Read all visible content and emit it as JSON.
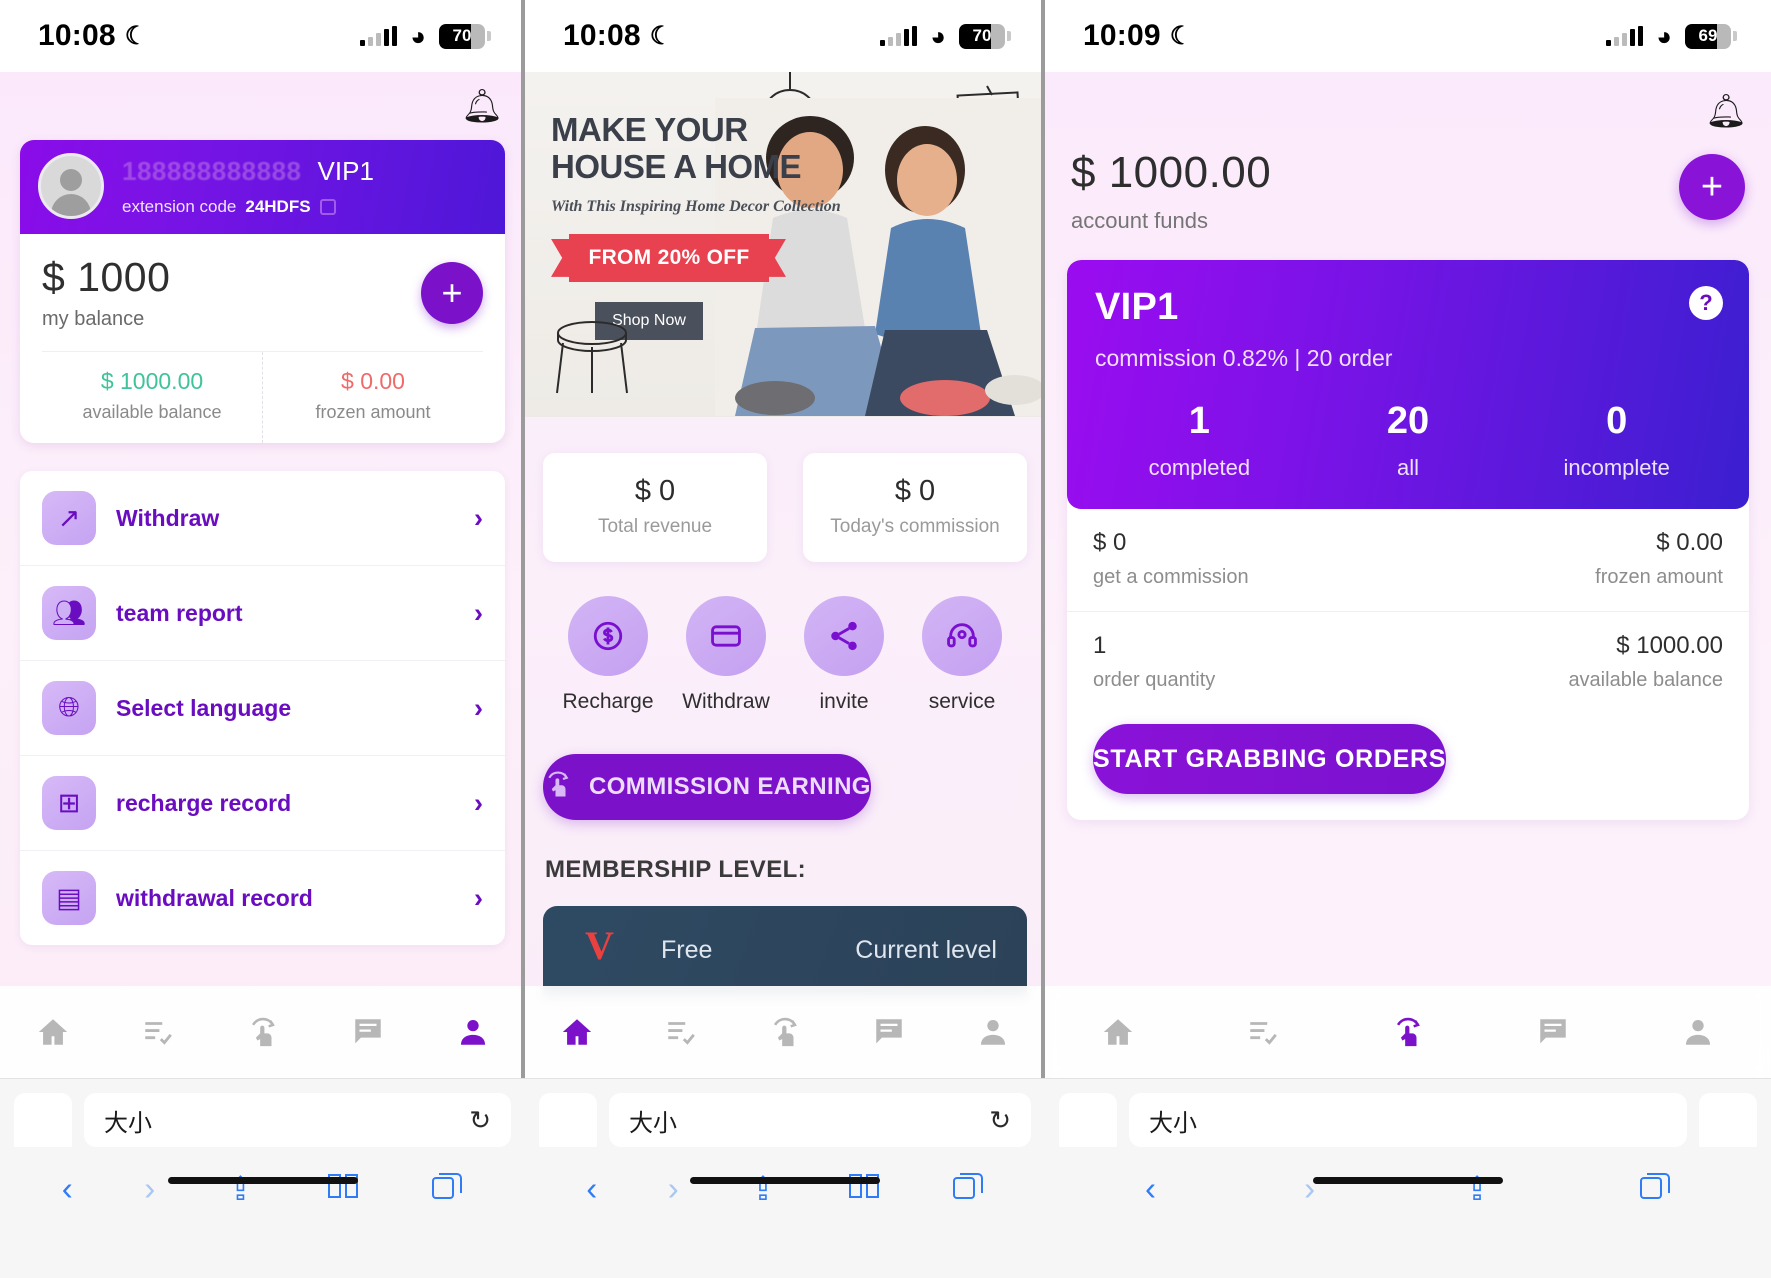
{
  "screens": [
    {
      "status": {
        "time": "10:08",
        "moon": "☾",
        "battery": "70"
      },
      "bell_icon": "bell-icon",
      "profile": {
        "phone": "188888888888",
        "vip": "VIP1",
        "extension_label": "extension code",
        "extension_code": "24HDFS"
      },
      "balance": {
        "amount": "$ 1000",
        "label": "my balance",
        "available_value": "$ 1000.00",
        "available_label": "available balance",
        "frozen_value": "$ 0.00",
        "frozen_label": "frozen amount"
      },
      "menu": [
        {
          "label": "Withdraw",
          "icon": "arrow-up-right-icon",
          "chevron": "›"
        },
        {
          "label": "team report",
          "icon": "people-group-icon",
          "chevron": "›"
        },
        {
          "label": "Select language",
          "icon": "globe-icon",
          "chevron": "›"
        },
        {
          "label": "recharge record",
          "icon": "add-card-icon",
          "chevron": "›"
        },
        {
          "label": "withdrawal record",
          "icon": "banknote-icon",
          "chevron": "›"
        }
      ],
      "tabs": [
        {
          "name": "home",
          "active": false
        },
        {
          "name": "orders",
          "active": false
        },
        {
          "name": "grab",
          "active": false
        },
        {
          "name": "chat",
          "active": false
        },
        {
          "name": "profile",
          "active": true
        }
      ]
    },
    {
      "status": {
        "time": "10:08",
        "moon": "☾",
        "battery": "70"
      },
      "banner": {
        "headline_1": "MAKE YOUR",
        "headline_2": "HOUSE A HOME",
        "subtitle": "With This Inspiring Home Decor Collection",
        "ribbon": "FROM 20% OFF",
        "cta": "Shop Now"
      },
      "stats": [
        {
          "value": "$ 0",
          "label": "Total revenue"
        },
        {
          "value": "$ 0",
          "label": "Today's commission"
        }
      ],
      "quick_actions": [
        {
          "label": "Recharge",
          "icon": "dollar-coin-icon"
        },
        {
          "label": "Withdraw",
          "icon": "credit-card-icon"
        },
        {
          "label": "invite",
          "icon": "share-icon"
        },
        {
          "label": "service",
          "icon": "headset-icon"
        }
      ],
      "commission_button": {
        "label": "COMMISSION EARNING",
        "icon": "tap-hand-icon"
      },
      "membership": {
        "title": "MEMBERSHIP LEVEL:",
        "badge": "V",
        "tier": "Free",
        "status": "Current level"
      },
      "tabs": [
        {
          "name": "home",
          "active": true
        },
        {
          "name": "orders",
          "active": false
        },
        {
          "name": "grab",
          "active": false
        },
        {
          "name": "chat",
          "active": false
        },
        {
          "name": "profile",
          "active": false
        }
      ]
    },
    {
      "status": {
        "time": "10:09",
        "moon": "☾",
        "battery": "69"
      },
      "bell_icon": "bell-icon",
      "funds": {
        "amount": "$ 1000.00",
        "label": "account funds",
        "add_button": "+"
      },
      "vip": {
        "title": "VIP1",
        "help": "?",
        "commission": "commission 0.82% | 20 order",
        "stats": [
          {
            "value": "1",
            "label": "completed"
          },
          {
            "value": "20",
            "label": "all"
          },
          {
            "value": "0",
            "label": "incomplete"
          }
        ]
      },
      "details": [
        {
          "left_value": "$ 0",
          "left_label": "get a commission",
          "right_value": "$ 0.00",
          "right_label": "frozen amount"
        },
        {
          "left_value": "1",
          "left_label": "order quantity",
          "right_value": "$ 1000.00",
          "right_label": "available balance"
        }
      ],
      "start_button": "START GRABBING ORDERS",
      "tabs": [
        {
          "name": "home",
          "active": false
        },
        {
          "name": "orders",
          "active": false
        },
        {
          "name": "grab",
          "active": true
        },
        {
          "name": "chat",
          "active": false
        },
        {
          "name": "profile",
          "active": false
        }
      ]
    }
  ],
  "browser": {
    "columns": [
      {
        "url_text": "大小",
        "reload": "↻",
        "back": "‹",
        "forward": "›",
        "share": "⇪",
        "bookmarks": "📖",
        "tabs": "⧉"
      },
      {
        "url_text": "大小",
        "reload": "↻",
        "back": "‹",
        "forward": "›",
        "share": "⇪",
        "bookmarks": "📖",
        "tabs": "⧉"
      },
      {
        "url_text": "大小",
        "reload": "↻",
        "back": "‹",
        "forward": "›",
        "share": "⇪",
        "bookmarks": "📖",
        "tabs": "⧉"
      }
    ]
  },
  "colors": {
    "brand_purple": "#7b12c9",
    "accent_violet": "#8a0ce8",
    "deep_blue": "#3b1fd0",
    "green": "#3fc39a",
    "red": "#f06a6a",
    "page_bg": "#fbeafb"
  }
}
